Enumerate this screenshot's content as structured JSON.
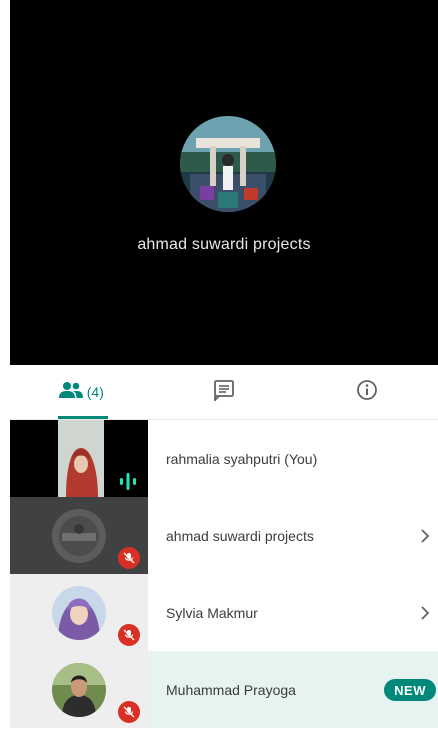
{
  "stage": {
    "presenter_name": "ahmad suwardi projects"
  },
  "tabs": {
    "participants_count": "(4)",
    "active": "participants"
  },
  "participants": [
    {
      "name": "rahmalia syahputri (You)",
      "status": "speaking"
    },
    {
      "name": "ahmad suwardi projects",
      "status": "muted"
    },
    {
      "name": "Sylvia Makmur",
      "status": "muted"
    },
    {
      "name": "Muhammad Prayoga",
      "status": "muted",
      "badge": "NEW"
    }
  ],
  "colors": {
    "accent": "#00897b",
    "muted_badge": "#d93025",
    "stage_bg": "#000000",
    "highlight_row": "#e6f3f1"
  }
}
